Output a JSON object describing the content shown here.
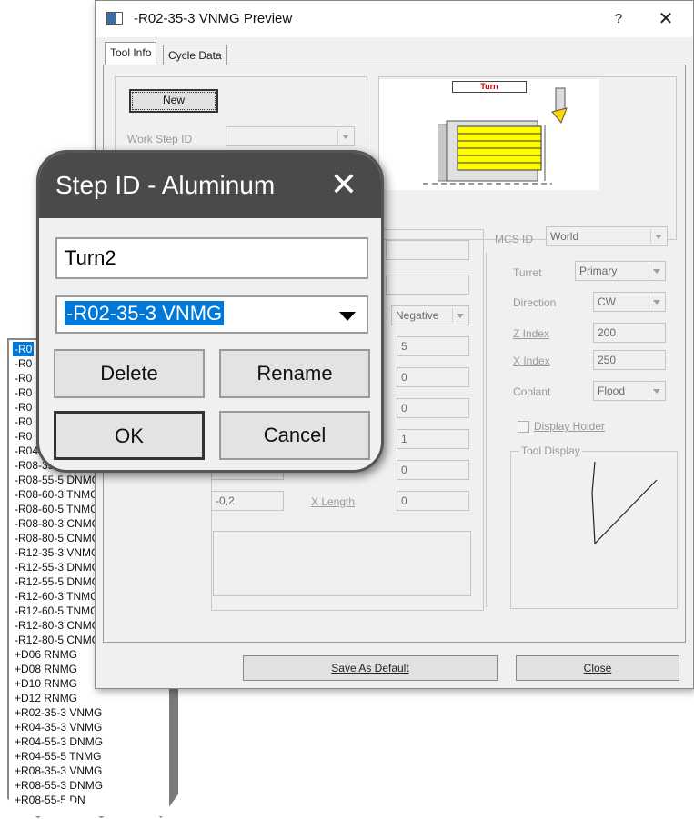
{
  "window": {
    "title": "-R02-35-3 VNMG Preview",
    "help": "?",
    "close": "✕"
  },
  "tabs": [
    "Tool Info",
    "Cycle Data"
  ],
  "left": {
    "new_button": "New",
    "work_step_label": "Work Step ID",
    "hand_value": "Negative",
    "fields": [
      "5",
      "0",
      "0",
      "1",
      "0"
    ],
    "x_length_label": "X Length",
    "x_length_value": "0",
    "small_value": "-0,2"
  },
  "preview": {
    "label": "Turn"
  },
  "right": {
    "mcs_label": "MCS ID",
    "mcs_value": "World",
    "turret_label": "Turret",
    "turret_value": "Primary",
    "direction_label": "Direction",
    "direction_value": "CW",
    "zindex_label": "Z Index",
    "zindex_value": "200",
    "xindex_label": "X Index",
    "xindex_value": "250",
    "coolant_label": "Coolant",
    "coolant_value": "Flood",
    "display_holder_label": "Display Holder",
    "tool_display_label": "Tool Display"
  },
  "footer": {
    "save_default": "Save As Default",
    "close": "Close"
  },
  "dropdown_list": [
    "-R0",
    "-R0",
    "-R0",
    "-R0",
    "-R0",
    "-R0",
    "-R0",
    "-R04",
    "-R08-35",
    "-R08-55-5 DNMG",
    "-R08-60-3 TNMG",
    "-R08-60-5 TNMG",
    "-R08-80-3 CNMG",
    "-R08-80-5 CNMG",
    "-R12-35-3 VNMG",
    "-R12-55-3 DNMG",
    "-R12-55-5 DNMG",
    "-R12-60-3 TNMG",
    "-R12-60-5 TNMG",
    "-R12-80-3 CNMG",
    "-R12-80-5 CNMG",
    "+D06 RNMG",
    "+D08 RNMG",
    "+D10 RNMG",
    "+D12 RNMG",
    "+R02-35-3 VNMG",
    "+R04-35-3 VNMG",
    "+R04-55-3 DNMG",
    "+R04-55-5 TNMG",
    "+R08-35-3 VNMG",
    "+R08-55-3 DNMG",
    "+R08-55-5 DN"
  ],
  "dialog": {
    "title": "Step ID - Aluminum",
    "close": "✕",
    "name_value": "Turn2",
    "selected_value": "-R02-35-3 VNMG",
    "delete": "Delete",
    "rename": "Rename",
    "ok": "OK",
    "cancel": "Cancel"
  },
  "colors": {
    "accent": "#0078d7",
    "dialog_header": "#4a4a4a",
    "stock": "#ffff00"
  }
}
